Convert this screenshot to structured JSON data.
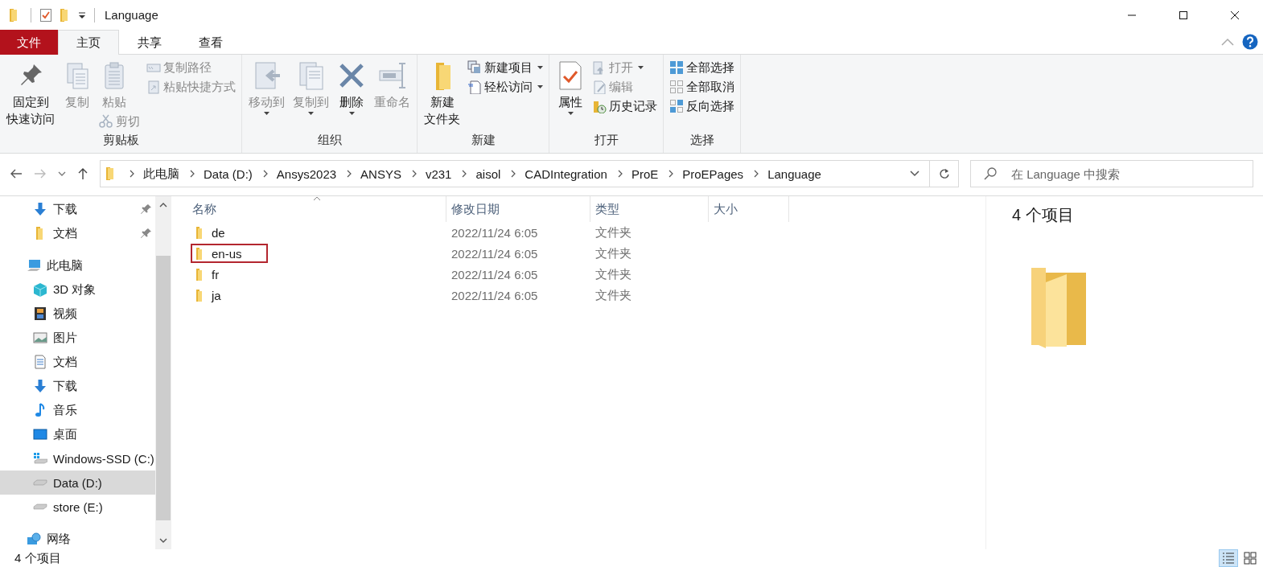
{
  "window": {
    "title": "Language"
  },
  "ribbon_tabs": [
    {
      "label": "文件",
      "kind": "file",
      "selected": false
    },
    {
      "label": "主页",
      "kind": "tab",
      "selected": true
    },
    {
      "label": "共享",
      "kind": "tab",
      "selected": false
    },
    {
      "label": "查看",
      "kind": "tab",
      "selected": false
    }
  ],
  "ribbon_groups": [
    {
      "label": "剪贴板",
      "columns": [
        [
          {
            "label": [
              "固定到",
              "快速访问"
            ],
            "kind": "large",
            "disabled": false,
            "dropdown": false
          }
        ],
        [
          {
            "label": "复制",
            "kind": "large",
            "disabled": true,
            "dropdown": false
          }
        ],
        [
          {
            "label": "粘贴",
            "kind": "large",
            "disabled": true,
            "dropdown": false
          },
          {
            "label": "剪切",
            "kind": "small",
            "disabled": true,
            "dropdown": false
          }
        ],
        [
          {
            "label": "复制路径",
            "kind": "small",
            "disabled": true,
            "dropdown": false
          },
          {
            "label": "粘贴快捷方式",
            "kind": "small",
            "disabled": true,
            "dropdown": false
          }
        ]
      ]
    },
    {
      "label": "组织",
      "columns": [
        [
          {
            "label": "移动到",
            "kind": "large",
            "disabled": true,
            "dropdown": true
          }
        ],
        [
          {
            "label": "复制到",
            "kind": "large",
            "disabled": true,
            "dropdown": true
          }
        ],
        [
          {
            "label": "删除",
            "kind": "large",
            "disabled": false,
            "dropdown": true
          }
        ],
        [
          {
            "label": "重命名",
            "kind": "large",
            "disabled": true,
            "dropdown": false
          }
        ]
      ]
    },
    {
      "label": "新建",
      "columns": [
        [
          {
            "label": [
              "新建",
              "文件夹"
            ],
            "kind": "large",
            "disabled": false,
            "dropdown": false
          }
        ],
        [
          {
            "label": "新建项目",
            "kind": "small",
            "disabled": false,
            "dropdown": true
          },
          {
            "label": "轻松访问",
            "kind": "small",
            "disabled": false,
            "dropdown": true
          }
        ]
      ]
    },
    {
      "label": "打开",
      "columns": [
        [
          {
            "label": "属性",
            "kind": "large",
            "disabled": false,
            "dropdown": true
          }
        ],
        [
          {
            "label": "打开",
            "kind": "small",
            "disabled": true,
            "dropdown": true
          },
          {
            "label": "编辑",
            "kind": "small",
            "disabled": true,
            "dropdown": false
          },
          {
            "label": "历史记录",
            "kind": "small",
            "disabled": false,
            "dropdown": false
          }
        ]
      ]
    },
    {
      "label": "选择",
      "columns": [
        [
          {
            "label": "全部选择",
            "kind": "small",
            "disabled": false,
            "dropdown": false
          },
          {
            "label": "全部取消",
            "kind": "small",
            "disabled": false,
            "dropdown": false
          },
          {
            "label": "反向选择",
            "kind": "small",
            "disabled": false,
            "dropdown": false
          }
        ]
      ]
    }
  ],
  "address": {
    "path": [
      "此电脑",
      "Data (D:)",
      "Ansys2023",
      "ANSYS",
      "v231",
      "aisol",
      "CADIntegration",
      "ProE",
      "ProEPages",
      "Language"
    ],
    "forward_disabled": true
  },
  "search": {
    "placeholder": "在 Language 中搜索"
  },
  "sidebar": {
    "quick_access": [
      {
        "label": "下载",
        "pinned": true,
        "selected": false
      },
      {
        "label": "文档",
        "pinned": true,
        "selected": false
      }
    ],
    "tree": [
      {
        "label": "此电脑",
        "selected": false,
        "children": [
          {
            "label": "3D 对象",
            "selected": false
          },
          {
            "label": "视频",
            "selected": false
          },
          {
            "label": "图片",
            "selected": false
          },
          {
            "label": "文档",
            "selected": false
          },
          {
            "label": "下载",
            "selected": false
          },
          {
            "label": "音乐",
            "selected": false
          },
          {
            "label": "桌面",
            "selected": false
          },
          {
            "label": "Windows-SSD (C:)",
            "selected": false
          },
          {
            "label": "Data (D:)",
            "selected": true
          },
          {
            "label": "store (E:)",
            "selected": false
          }
        ]
      },
      {
        "label": "网络",
        "selected": false
      }
    ]
  },
  "table": {
    "columns": [
      "名称",
      "修改日期",
      "类型",
      "大小"
    ],
    "rows": [
      {
        "name": "de",
        "date": "2022/11/24 6:05",
        "type": "文件夹",
        "highlighted": false
      },
      {
        "name": "en-us",
        "date": "2022/11/24 6:05",
        "type": "文件夹",
        "highlighted": true
      },
      {
        "name": "fr",
        "date": "2022/11/24 6:05",
        "type": "文件夹",
        "highlighted": false
      },
      {
        "name": "ja",
        "date": "2022/11/24 6:05",
        "type": "文件夹",
        "highlighted": false
      }
    ]
  },
  "details_pane": {
    "count": "4 个项目"
  },
  "status_bar": {
    "count": "4 个项目",
    "views": [
      {
        "kind": "details",
        "selected": true
      },
      {
        "kind": "large-icons",
        "selected": false
      }
    ]
  }
}
